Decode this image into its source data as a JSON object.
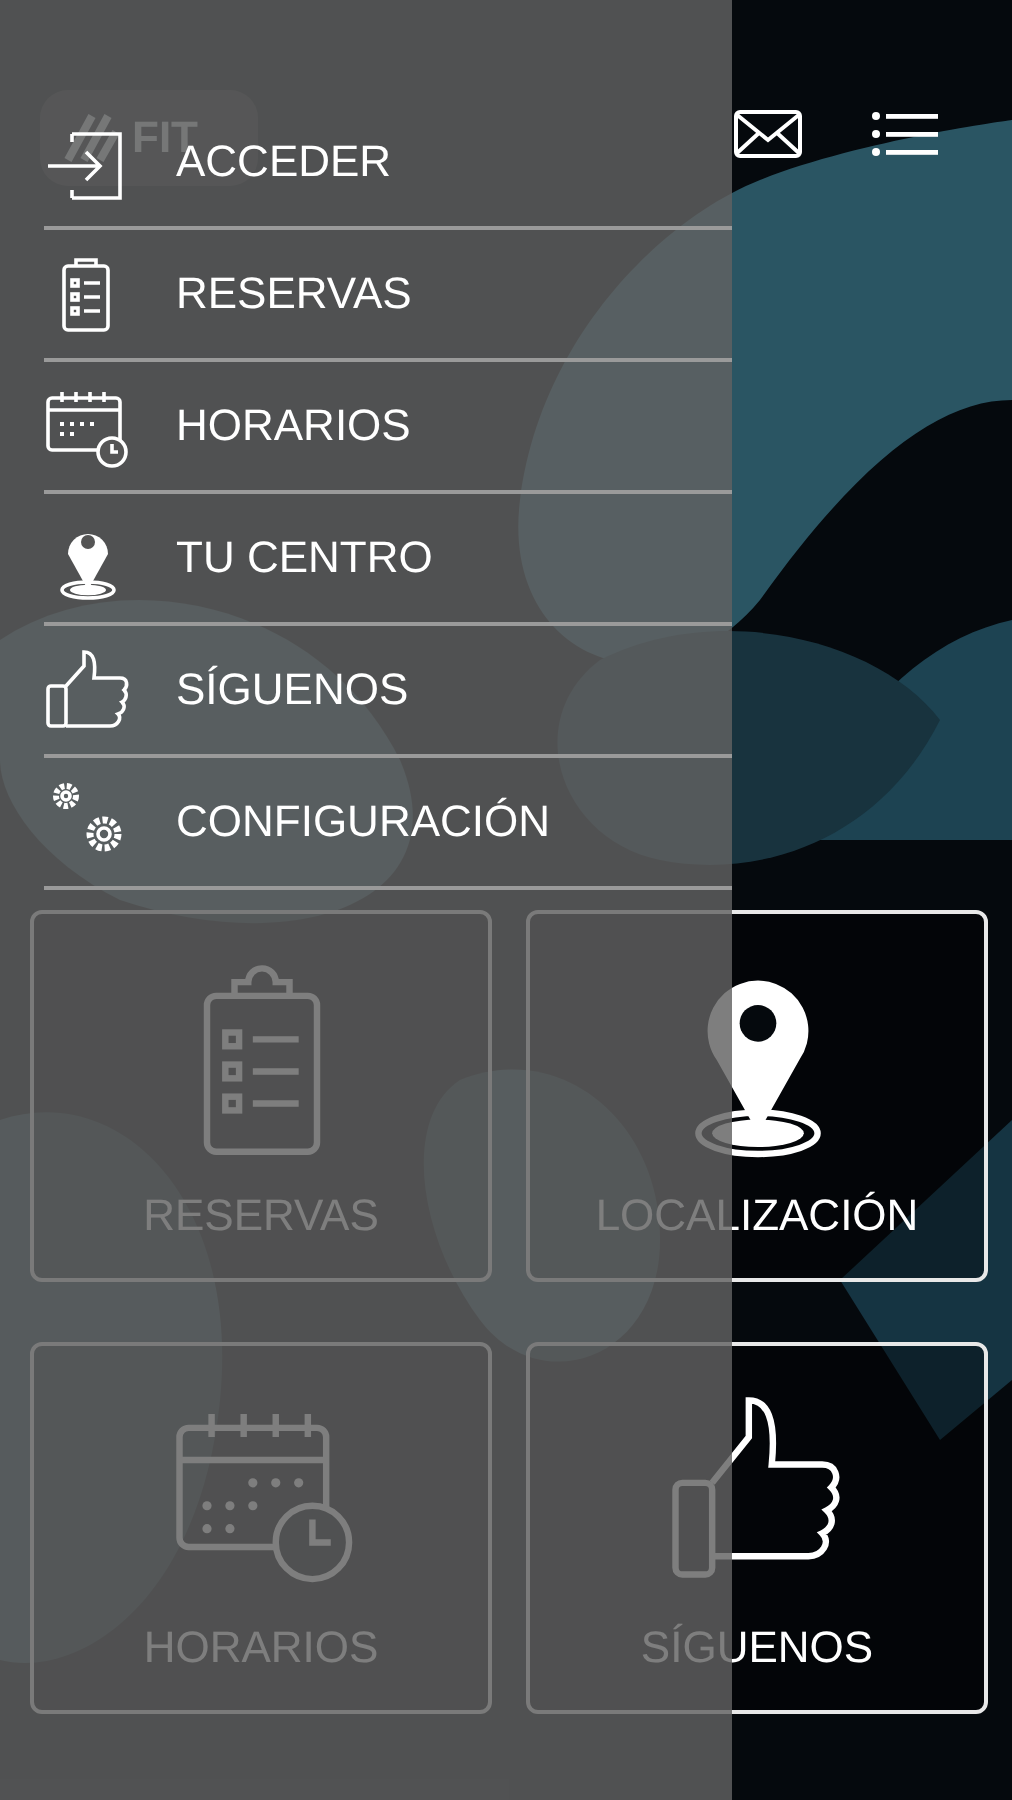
{
  "header": {
    "logo": "FIT"
  },
  "tiles": [
    {
      "label": "RESERVAS",
      "kind": "clipboard"
    },
    {
      "label": "LOCALIZACIÓN",
      "kind": "pin"
    },
    {
      "label": "HORARIOS",
      "kind": "calendar"
    },
    {
      "label": "SÍGUENOS",
      "kind": "thumb"
    }
  ],
  "drawer": {
    "items": [
      {
        "label": "ACCEDER",
        "kind": "login"
      },
      {
        "label": "RESERVAS",
        "kind": "clipboard"
      },
      {
        "label": "HORARIOS",
        "kind": "calendar"
      },
      {
        "label": "TU CENTRO",
        "kind": "pin"
      },
      {
        "label": "SÍGUENOS",
        "kind": "thumb"
      },
      {
        "label": "CONFIGURACIÓN",
        "kind": "gears"
      }
    ]
  }
}
